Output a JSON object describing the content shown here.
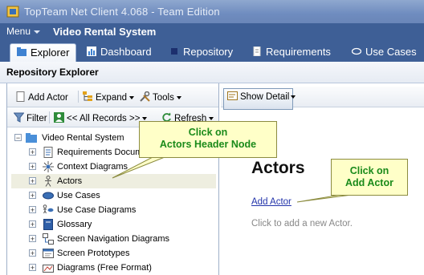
{
  "window": {
    "title": "TopTeam Net Client 4.068 - Team Edition"
  },
  "menubar": {
    "menu_label": "Menu",
    "system_name": "Video Rental System"
  },
  "tabs": [
    {
      "label": "Explorer",
      "icon": "explorer-icon",
      "active": true
    },
    {
      "label": "Dashboard",
      "icon": "dashboard-icon"
    },
    {
      "label": "Repository",
      "icon": "repository-icon"
    },
    {
      "label": "Requirements",
      "icon": "document-icon"
    },
    {
      "label": "Use Cases",
      "icon": "use-case-icon"
    }
  ],
  "explorer": {
    "header": "Repository Explorer",
    "toolbar": {
      "add_actor": "Add Actor",
      "expand": "Expand",
      "tools": "Tools"
    },
    "filterbar": {
      "filter": "Filter",
      "records": "<< All Records >>",
      "refresh": "Refresh"
    },
    "tree": {
      "root": "Video Rental System",
      "items": [
        {
          "label": "Requirements Docum",
          "icon": "requirements-doc-icon"
        },
        {
          "label": "Context Diagrams",
          "icon": "context-diagram-icon"
        },
        {
          "label": "Actors",
          "icon": "actor-icon",
          "selected": true
        },
        {
          "label": "Use Cases",
          "icon": "use-case-icon"
        },
        {
          "label": "Use Case Diagrams",
          "icon": "use-case-diagram-icon"
        },
        {
          "label": "Glossary",
          "icon": "glossary-icon"
        },
        {
          "label": "Screen Navigation Diagrams",
          "icon": "navigation-diagram-icon"
        },
        {
          "label": "Screen Prototypes",
          "icon": "prototype-icon"
        },
        {
          "label": "Diagrams (Free Format)",
          "icon": "free-diagram-icon"
        }
      ]
    }
  },
  "detail": {
    "show_detail": "Show Detail",
    "heading": "Actors",
    "add_link": "Add Actor",
    "hint": "Click to add a new Actor."
  },
  "callouts": {
    "header_node": {
      "line1": "Click on",
      "line2": "Actors Header Node"
    },
    "add_actor": {
      "line1": "Click on",
      "line2": "Add Actor"
    }
  },
  "colors": {
    "accent": "#3e5f96",
    "callout_text": "#1a8a1a",
    "callout_bg": "#ffffc8"
  }
}
